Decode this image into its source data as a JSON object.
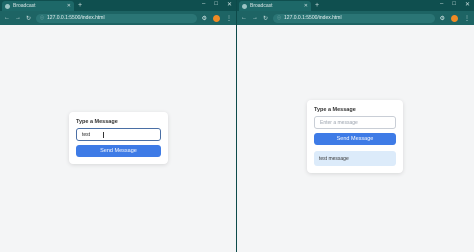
{
  "left_window": {
    "tab_title": "Broadcast",
    "url": "127.0.0.1:5500/index.html",
    "card_title": "Type a Message",
    "input_value": "test",
    "button_label": "Send Message"
  },
  "right_window": {
    "tab_title": "Broadcast",
    "url": "127.0.0.1:5500/index.html",
    "card_title": "Type a Message",
    "input_placeholder": "Enter a message",
    "button_label": "Send Message",
    "messages": [
      "test message"
    ]
  },
  "colors": {
    "chrome_dark": "#0f4f4f",
    "chrome_toolbar": "#1d6464",
    "accent_button": "#3e7be6",
    "message_bg": "#dcebfa"
  }
}
